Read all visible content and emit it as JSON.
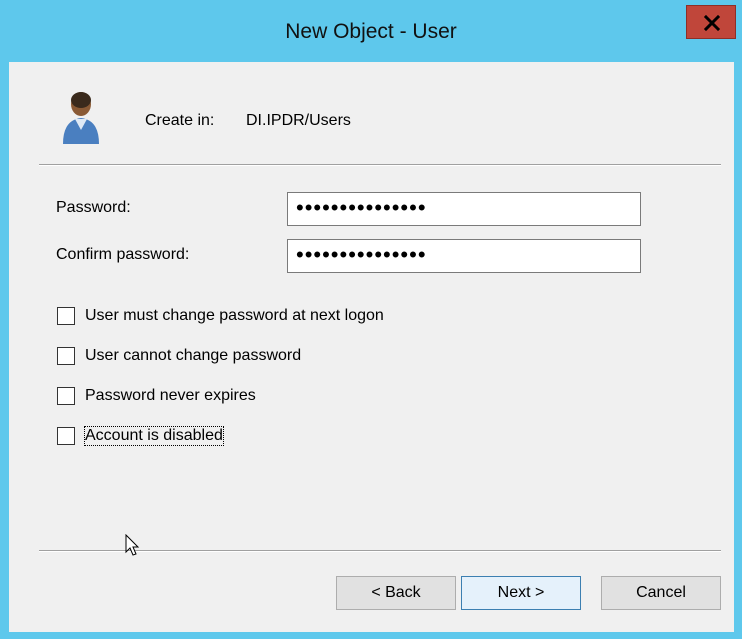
{
  "window": {
    "title": "New Object - User",
    "close_glyph": "X"
  },
  "header": {
    "icon": "user-icon",
    "create_in_label": "Create in:",
    "create_in_path": "DI.IPDR/Users"
  },
  "form": {
    "password_label": "Password:",
    "password_value": "•••••••••••••••",
    "confirm_label": "Confirm password:",
    "confirm_value": "•••••••••••••••"
  },
  "options": [
    {
      "label": "User must change password at next logon",
      "checked": false
    },
    {
      "label": "User cannot change password",
      "checked": false
    },
    {
      "label": "Password never expires",
      "checked": false
    },
    {
      "label": "Account is disabled",
      "checked": false
    }
  ],
  "buttons": {
    "back": "< Back",
    "next": "Next >",
    "cancel": "Cancel"
  },
  "colors": {
    "title_bar": "#5ec8ec",
    "close_button": "#c0463a",
    "dialog_body": "#f0f0f0"
  }
}
